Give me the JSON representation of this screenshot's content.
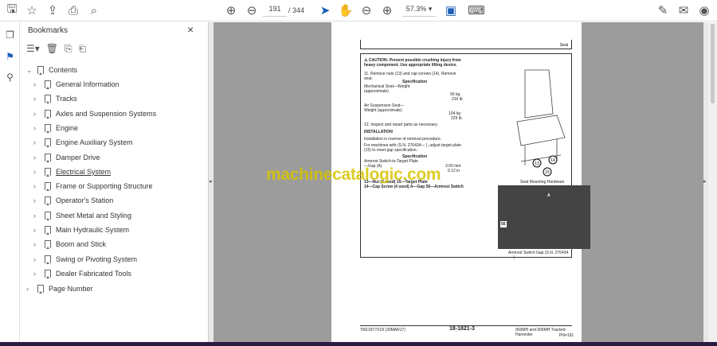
{
  "toolbar": {
    "page_current": "191",
    "page_total": "/ 344",
    "zoom": "57.3%"
  },
  "bookmarks": {
    "title": "Bookmarks",
    "close": "×",
    "root": "Contents",
    "items": [
      "General Information",
      "Tracks",
      "Axles and Suspension Systems",
      "Engine",
      "Engine Auxiliary System",
      "Damper Drive",
      "Electrical System",
      "Frame or Supporting Structure",
      "Operator's Station",
      "Sheet Metal and Styling",
      "Main Hydraulic System",
      "Boom and Stick",
      "Swing or Pivoting System",
      "Dealer Fabricated Tools"
    ],
    "last": "Page Number"
  },
  "document": {
    "header": "Seat",
    "caution": "CAUTION: Prevent possible crushing injury from heavy component. Use appropriate lifting device.",
    "step11": "11. Remove nuts (13) and cap screws (14). Remove seat.",
    "spec_title": "Specification",
    "mech": "Mechanical Seat—Weight (approximate)",
    "mech_val": "90 kg",
    "mech_val2": "216 lb",
    "air": "Air Suspension Seat—Weight (approximate)",
    "air_val": "104 kg",
    "air_val2": "229 lb",
    "step12": "12. Inspect and repair parts as necessary.",
    "install": "INSTALLATION",
    "install_text": "Installation is reverse of removal procedure.",
    "machines": "For machines with (S.N. 276434— ), adjust target plate (15) to meet gap specification.",
    "gap": "Armrest Switch-to-Target Plate—Gap (A)",
    "gap_val": "3.00 mm",
    "gap_val2": "0.12 in",
    "legend1": "13—Nut (4 used)   15—Target Plate",
    "legend2": "14—Cap Screw (4 used)   A—Gap   56—Armrest Switch",
    "cap1": "Seat Mounting Hardware",
    "cap2": "Armrest Switch Gap (S.N. 276434— )",
    "callouts": [
      "13",
      "14",
      "15",
      "A",
      "56"
    ],
    "footer_left": "TM13377X19 (30MAR17)",
    "footer_mid": "18-1821-3",
    "footer_right": "903MH and 909MH Tracked Harvester",
    "footer_page": "PN=191"
  },
  "watermark": "machinecatalogic.com"
}
